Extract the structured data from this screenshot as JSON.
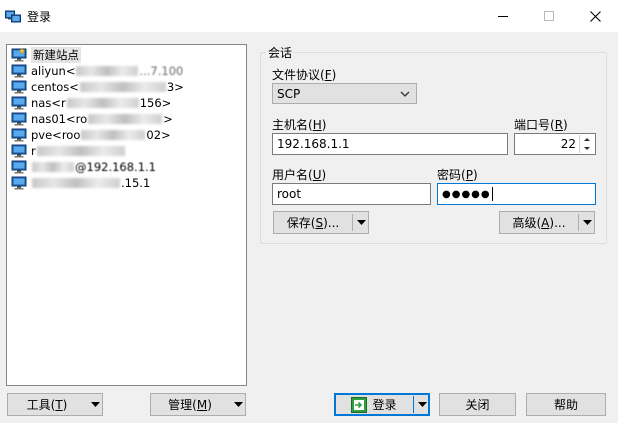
{
  "window": {
    "title": "登录",
    "minimize_glyph": "—",
    "maximize_glyph": "☐",
    "close_glyph": "✕"
  },
  "sites": [
    {
      "label": "新建站点",
      "icon": "new-site-icon",
      "selected": true
    },
    {
      "label_start": "aliyun<",
      "label_end": "...7.100",
      "icon": "monitor-icon"
    },
    {
      "label_start": "centos<",
      "label_end": "3>",
      "icon": "monitor-icon"
    },
    {
      "label_start": "nas<r",
      "label_end": "156>",
      "icon": "monitor-icon"
    },
    {
      "label_start": "nas01<ro",
      "label_end": ">",
      "icon": "monitor-icon"
    },
    {
      "label_start": "pve<roo",
      "label_end": "02>",
      "icon": "monitor-icon"
    },
    {
      "label_start": "r",
      "label_end": "",
      "icon": "monitor-icon"
    },
    {
      "label_start": "",
      "label_end": "@192.168.1.1",
      "icon": "monitor-icon"
    },
    {
      "label_start": "",
      "label_end": ".15.1",
      "icon": "monitor-icon"
    }
  ],
  "session": {
    "group_title": "会话",
    "protocol": {
      "label": "文件协议",
      "key": "F",
      "value": "SCP"
    },
    "host": {
      "label": "主机名",
      "key": "H",
      "value": "192.168.1.1"
    },
    "port": {
      "label": "端口号",
      "key": "R",
      "value": "22"
    },
    "user": {
      "label": "用户名",
      "key": "U",
      "value": "root"
    },
    "password": {
      "label": "密码",
      "key": "P",
      "masked": "●●●●●"
    },
    "save_button": {
      "label": "保存",
      "key": "S",
      "suffix": "..."
    },
    "advanced_button": {
      "label": "高级",
      "key": "A",
      "suffix": "..."
    }
  },
  "bottom": {
    "tools": {
      "label": "工具",
      "key": "T"
    },
    "manage": {
      "label": "管理",
      "key": "M"
    },
    "login": {
      "label": "登录"
    },
    "close": {
      "label": "关闭"
    },
    "help": {
      "label": "帮助"
    }
  },
  "colors": {
    "accent": "#0078d7",
    "login_icon_green": "#2e9e3e",
    "monitor_blue": "#1f5fa8"
  }
}
